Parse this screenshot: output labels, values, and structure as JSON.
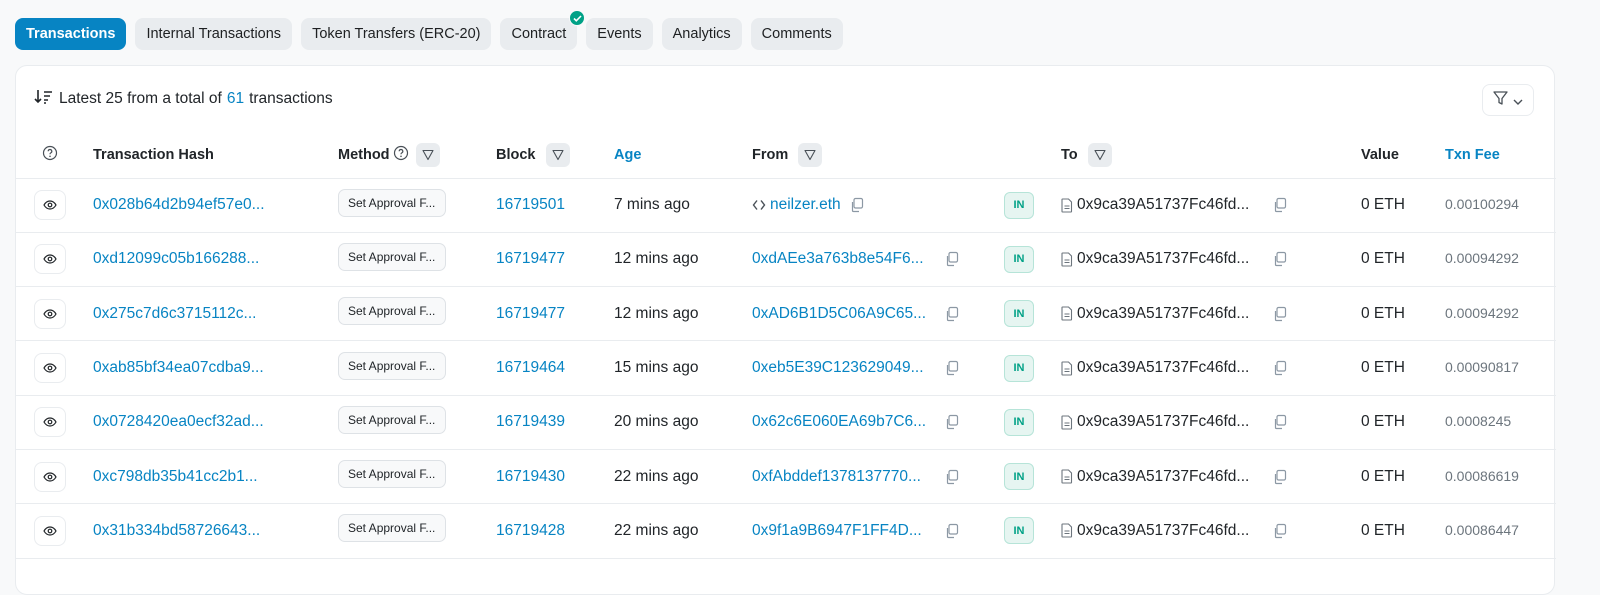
{
  "tabs": [
    {
      "label": "Transactions",
      "active": true
    },
    {
      "label": "Internal Transactions",
      "active": false
    },
    {
      "label": "Token Transfers (ERC-20)",
      "active": false
    },
    {
      "label": "Contract",
      "active": false,
      "verified": true
    },
    {
      "label": "Events",
      "active": false
    },
    {
      "label": "Analytics",
      "active": false
    },
    {
      "label": "Comments",
      "active": false
    }
  ],
  "summary": {
    "prefix": "Latest 25 from a total of",
    "count": "61",
    "suffix": "transactions"
  },
  "columns": {
    "hash": "Transaction Hash",
    "method": "Method",
    "block": "Block",
    "age": "Age",
    "from": "From",
    "to": "To",
    "value": "Value",
    "fee": "Txn Fee"
  },
  "rows": [
    {
      "hash": "0x028b64d2b94ef57e0...",
      "method": "Set Approval F...",
      "block": "16719501",
      "age": "7 mins ago",
      "from": "neilzer.eth",
      "from_is_ens": true,
      "direction": "IN",
      "to": "0x9ca39A51737Fc46fd...",
      "value": "0 ETH",
      "fee": "0.00100294"
    },
    {
      "hash": "0xd12099c05b166288...",
      "method": "Set Approval F...",
      "block": "16719477",
      "age": "12 mins ago",
      "from": "0xdAEe3a763b8e54F6...",
      "from_is_ens": false,
      "direction": "IN",
      "to": "0x9ca39A51737Fc46fd...",
      "value": "0 ETH",
      "fee": "0.00094292"
    },
    {
      "hash": "0x275c7d6c3715112c...",
      "method": "Set Approval F...",
      "block": "16719477",
      "age": "12 mins ago",
      "from": "0xAD6B1D5C06A9C65...",
      "from_is_ens": false,
      "direction": "IN",
      "to": "0x9ca39A51737Fc46fd...",
      "value": "0 ETH",
      "fee": "0.00094292"
    },
    {
      "hash": "0xab85bf34ea07cdba9...",
      "method": "Set Approval F...",
      "block": "16719464",
      "age": "15 mins ago",
      "from": "0xeb5E39C123629049...",
      "from_is_ens": false,
      "direction": "IN",
      "to": "0x9ca39A51737Fc46fd...",
      "value": "0 ETH",
      "fee": "0.00090817"
    },
    {
      "hash": "0x0728420ea0ecf32ad...",
      "method": "Set Approval F...",
      "block": "16719439",
      "age": "20 mins ago",
      "from": "0x62c6E060EA69b7C6...",
      "from_is_ens": false,
      "direction": "IN",
      "to": "0x9ca39A51737Fc46fd...",
      "value": "0 ETH",
      "fee": "0.0008245"
    },
    {
      "hash": "0xc798db35b41cc2b1...",
      "method": "Set Approval F...",
      "block": "16719430",
      "age": "22 mins ago",
      "from": "0xfAbddef1378137770...",
      "from_is_ens": false,
      "direction": "IN",
      "to": "0x9ca39A51737Fc46fd...",
      "value": "0 ETH",
      "fee": "0.00086619"
    },
    {
      "hash": "0x31b334bd58726643...",
      "method": "Set Approval F...",
      "block": "16719428",
      "age": "22 mins ago",
      "from": "0x9f1a9B6947F1FF4D...",
      "from_is_ens": false,
      "direction": "IN",
      "to": "0x9ca39A51737Fc46fd...",
      "value": "0 ETH",
      "fee": "0.00086447"
    }
  ],
  "colors": {
    "accent": "#0784c3",
    "in_badge": "#00a186",
    "verified": "#00a186"
  }
}
